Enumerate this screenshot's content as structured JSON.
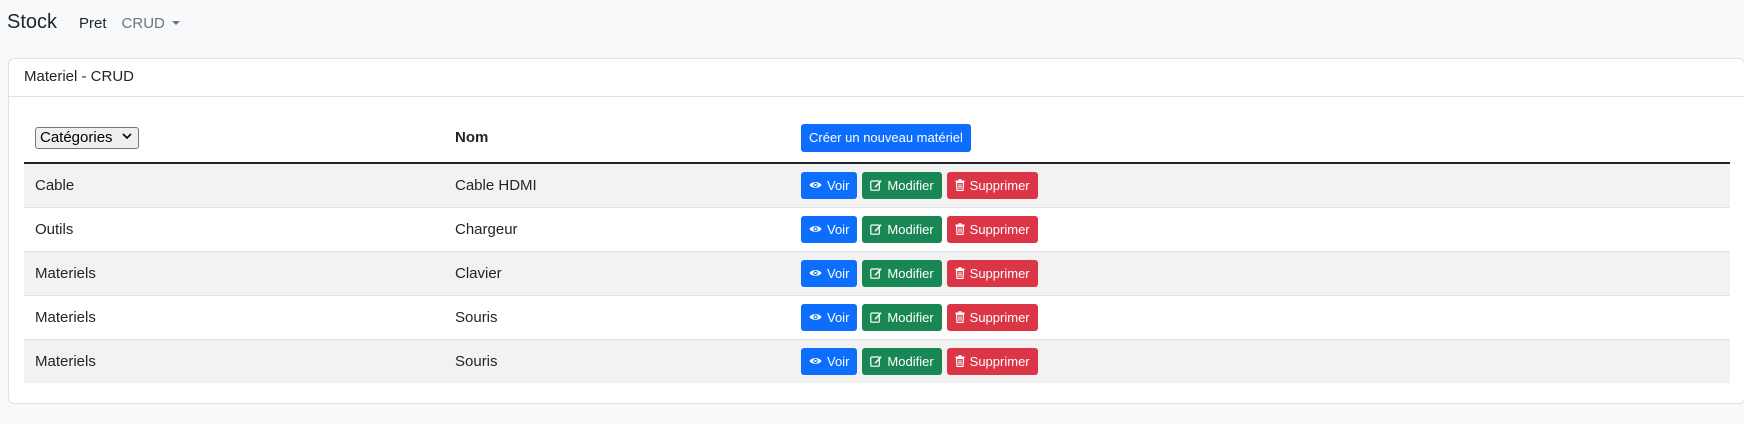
{
  "navbar": {
    "brand": "Stock",
    "links": [
      "Pret"
    ],
    "dropdown_label": "CRUD"
  },
  "card": {
    "title": "Materiel - CRUD"
  },
  "table": {
    "category_select": "Catégories",
    "nom_header": "Nom",
    "create_button": "Créer un nouveau matériel",
    "rows": [
      {
        "categorie": "Cable",
        "nom": "Cable HDMI"
      },
      {
        "categorie": "Outils",
        "nom": "Chargeur"
      },
      {
        "categorie": "Materiels",
        "nom": "Clavier"
      },
      {
        "categorie": "Materiels",
        "nom": "Souris"
      },
      {
        "categorie": "Materiels",
        "nom": "Souris"
      }
    ],
    "actions": {
      "view": "Voir",
      "edit": "Modifier",
      "delete": "Supprimer"
    }
  },
  "colors": {
    "primary": "#0d6efd",
    "success": "#198754",
    "danger": "#dc3545",
    "stripe": "#f2f2f2"
  },
  "icons": {
    "view": "eye-icon",
    "edit": "edit-icon",
    "delete": "trash-icon"
  }
}
